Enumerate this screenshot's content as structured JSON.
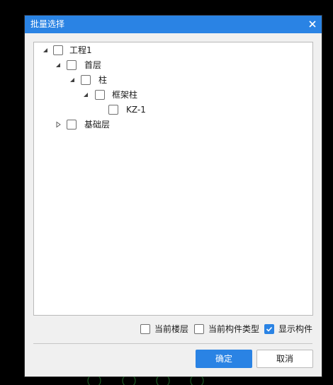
{
  "dialog": {
    "title": "批量选择",
    "close_icon": "close-icon"
  },
  "tree": [
    {
      "id": "project",
      "label": "工程1",
      "level": 0,
      "expanded": true,
      "checked": false
    },
    {
      "id": "floor1",
      "label": "首层",
      "level": 1,
      "expanded": true,
      "checked": false
    },
    {
      "id": "column",
      "label": "柱",
      "level": 2,
      "expanded": true,
      "checked": false
    },
    {
      "id": "frame-column",
      "label": "框架柱",
      "level": 3,
      "expanded": true,
      "checked": false
    },
    {
      "id": "kz1",
      "label": "KZ-1",
      "level": 4,
      "leaf": true,
      "checked": false
    },
    {
      "id": "foundation",
      "label": "基础层",
      "level": 1,
      "expanded": false,
      "checked": false
    }
  ],
  "options": {
    "current_floor": {
      "label": "当前楼层",
      "checked": false
    },
    "current_type": {
      "label": "当前构件类型",
      "checked": false
    },
    "show_components": {
      "label": "显示构件",
      "checked": true
    }
  },
  "buttons": {
    "ok": "确定",
    "cancel": "取消"
  },
  "colors": {
    "accent": "#2a83e4",
    "background": "#f0f0f0"
  }
}
